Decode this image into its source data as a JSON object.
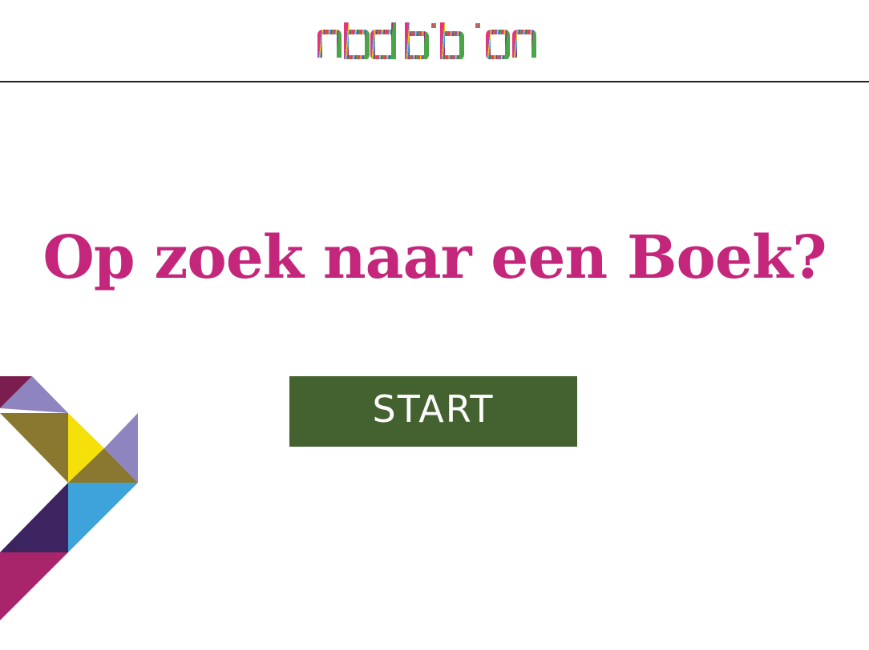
{
  "header": {
    "logo_text": "nbd biblion",
    "logo_colors": [
      "#e8327c",
      "#8c5dc9",
      "#f5c800",
      "#3aa3dc",
      "#9b2a7a",
      "#4aa547",
      "#e84e1b"
    ]
  },
  "main": {
    "headline": "Op zoek naar een Boek?",
    "start_label": "START"
  },
  "colors": {
    "headline": "#c3267a",
    "button_bg": "#43622f",
    "button_text": "#ffffff",
    "divider": "#222222",
    "decoration": [
      "#7b1d4f",
      "#8e84c0",
      "#8a7830",
      "#f5e00a",
      "#3ea2db",
      "#3b2460",
      "#a8246b"
    ]
  }
}
